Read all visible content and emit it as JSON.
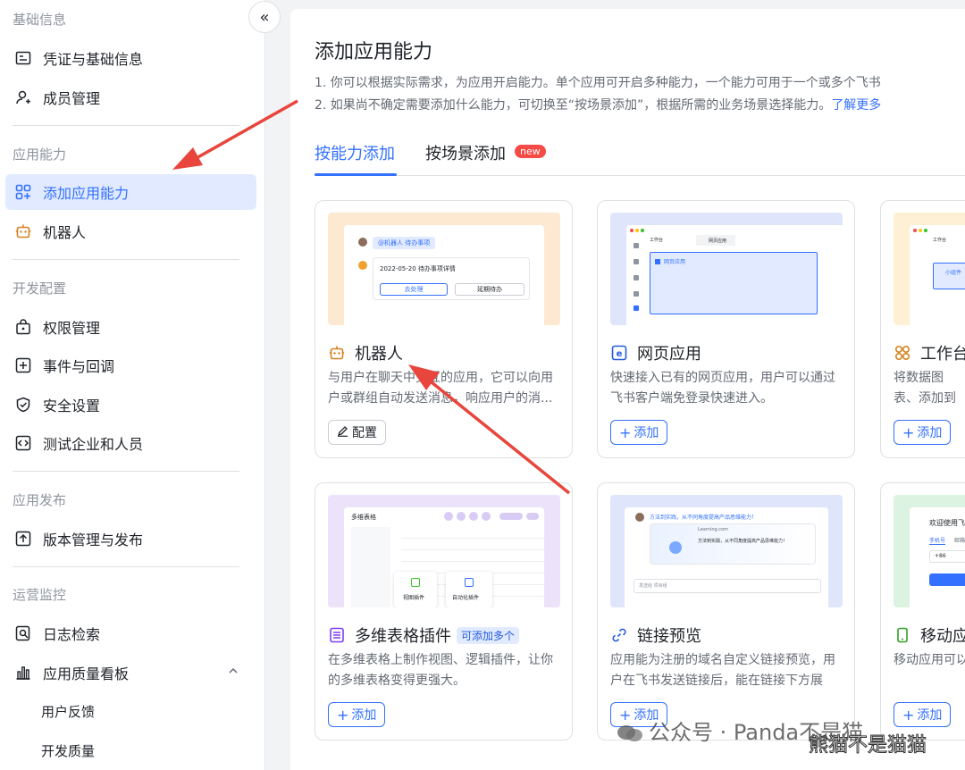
{
  "sidebar": {
    "groups": {
      "basic": "基础信息",
      "capability": "应用能力",
      "dev": "开发配置",
      "release": "应用发布",
      "ops": "运营监控"
    },
    "items": [
      {
        "label": "凭证与基础信息",
        "icon": "credential-icon"
      },
      {
        "label": "成员管理",
        "icon": "member-icon"
      },
      {
        "label": "添加应用能力",
        "icon": "add-capability-icon",
        "active": true
      },
      {
        "label": "机器人",
        "icon": "robot-icon"
      },
      {
        "label": "权限管理",
        "icon": "permission-icon"
      },
      {
        "label": "事件与回调",
        "icon": "event-icon"
      },
      {
        "label": "安全设置",
        "icon": "shield-icon"
      },
      {
        "label": "测试企业和人员",
        "icon": "test-icon"
      },
      {
        "label": "版本管理与发布",
        "icon": "upload-icon"
      },
      {
        "label": "日志检索",
        "icon": "log-search-icon"
      },
      {
        "label": "应用质量看板",
        "icon": "chart-icon"
      },
      {
        "label": "用户反馈"
      },
      {
        "label": "开发质量"
      }
    ],
    "collapse_icon": "«"
  },
  "main": {
    "title": "添加应用能力",
    "desc1": "1. 你可以根据实际需求，为应用开启能力。单个应用可开启多种能力，一个能力可用于一个或多个飞书",
    "desc2": "2. 如果尚不确定需要添加什么能力，可切换至“按场景添加”，根据所需的业务场景选择能力。",
    "learn_more": "了解更多",
    "tabs": [
      {
        "label": "按能力添加",
        "active": true
      },
      {
        "label": "按场景添加",
        "badge": "new"
      }
    ]
  },
  "cards": [
    {
      "title": "机器人",
      "icon": "robot-icon",
      "desc": "与用户在聊天中交互的应用，它可以向用户或群组自动发送消息，响应用户的消...",
      "button": "配置",
      "button_icon": "edit-icon",
      "preview": {
        "mention": "@机器人 待办事项",
        "line": "2022-05-20 待办事项详情",
        "btn1": "去处理",
        "btn2": "延期待办"
      }
    },
    {
      "title": "网页应用",
      "icon": "web-app-icon",
      "desc": "快速接入已有的网页应用，用户可以通过飞书客户端免登录快速进入。",
      "button": "添加",
      "preview": {
        "tab1": "工作台",
        "tab2": "网页应用",
        "box": "网页应用"
      }
    },
    {
      "title": "工作台",
      "icon": "workbench-icon",
      "desc": "将数据图表、添加到工作台",
      "button": "添加",
      "preview": {
        "tab1": "工作台",
        "box": "小组件"
      }
    },
    {
      "title": "多维表格插件",
      "icon": "bitable-icon",
      "tag": "可添加多个",
      "desc": "在多维表格上制作视图、逻辑插件，让你的多维表格变得更强大。",
      "button": "添加",
      "preview": {
        "header": "多维表格",
        "p1": "视图插件",
        "p2": "自动化插件"
      }
    },
    {
      "title": "链接预览",
      "icon": "link-icon",
      "desc": "应用能为注册的域名自定义链接预览，用户在飞书发送链接后，能在链接下方展示...",
      "button": "添加",
      "preview": {
        "msg": "方法到实践，从不同角度提高产品思维能力！",
        "site": "Learning.com",
        "body": "方法到实践，从不同角度提高产品思维能力！",
        "input": "发送给 项目组"
      }
    },
    {
      "title": "移动应",
      "icon": "mobile-icon",
      "desc": "移动应用可以",
      "button": "添加",
      "preview": {
        "welcome": "欢迎使用飞",
        "tab": "手机号",
        "tab2": "邮箱",
        "code": "+86"
      }
    }
  ],
  "watermark": {
    "text": "公众号 · Panda不是猫",
    "overlay": "熊猫不是猫猫"
  },
  "colors": {
    "accent": "#3370ff",
    "active_bg": "#e1eaff",
    "arrow": "#e8453c"
  }
}
